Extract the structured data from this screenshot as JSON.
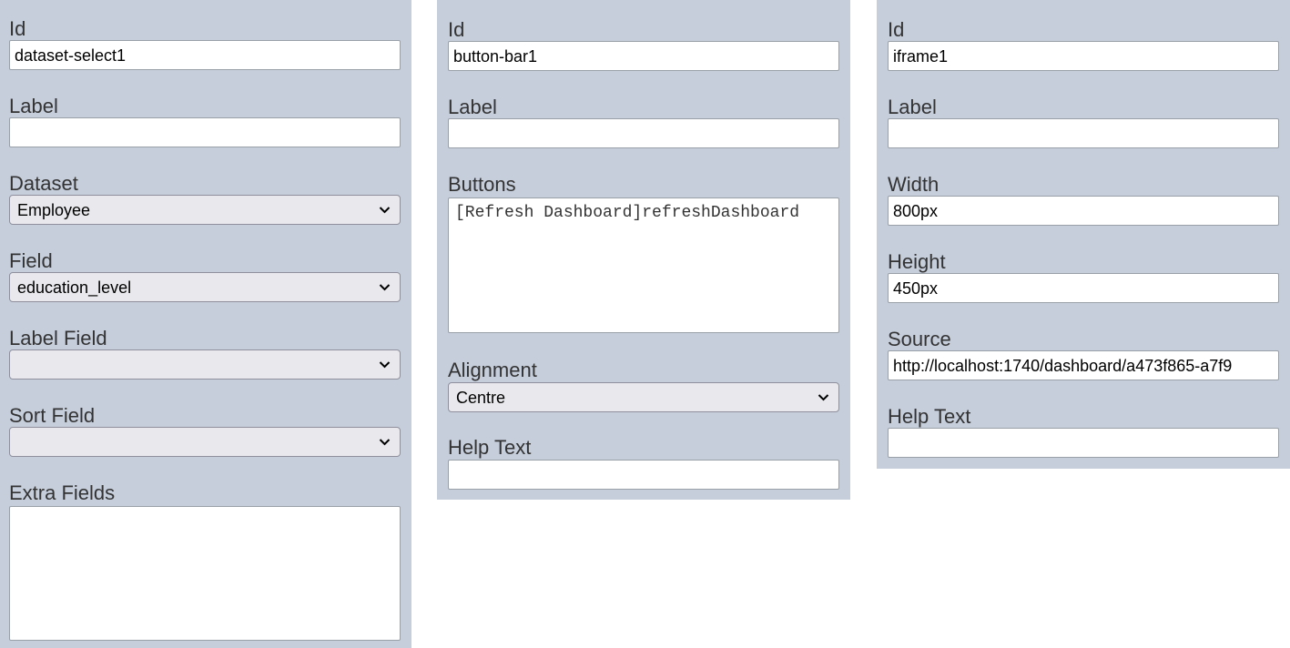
{
  "panel_left": {
    "id_label": "Id",
    "id_value": "dataset-select1",
    "label_label": "Label",
    "label_value": "",
    "dataset_label": "Dataset",
    "dataset_value": "Employee",
    "field_label": "Field",
    "field_value": "education_level",
    "label_field_label": "Label Field",
    "label_field_value": "",
    "sort_field_label": "Sort Field",
    "sort_field_value": "",
    "extra_fields_label": "Extra Fields",
    "extra_fields_value": ""
  },
  "panel_middle": {
    "id_label": "Id",
    "id_value": "button-bar1",
    "label_label": "Label",
    "label_value": "",
    "buttons_label": "Buttons",
    "buttons_value": "[Refresh Dashboard]refreshDashboard",
    "alignment_label": "Alignment",
    "alignment_value": "Centre",
    "help_text_label": "Help Text",
    "help_text_value": ""
  },
  "panel_right": {
    "id_label": "Id",
    "id_value": "iframe1",
    "label_label": "Label",
    "label_value": "",
    "width_label": "Width",
    "width_value": "800px",
    "height_label": "Height",
    "height_value": "450px",
    "source_label": "Source",
    "source_value": "http://localhost:1740/dashboard/a473f865-a7f9",
    "help_text_label": "Help Text",
    "help_text_value": ""
  },
  "icons": {
    "dropdown": "chevron-down-icon"
  }
}
